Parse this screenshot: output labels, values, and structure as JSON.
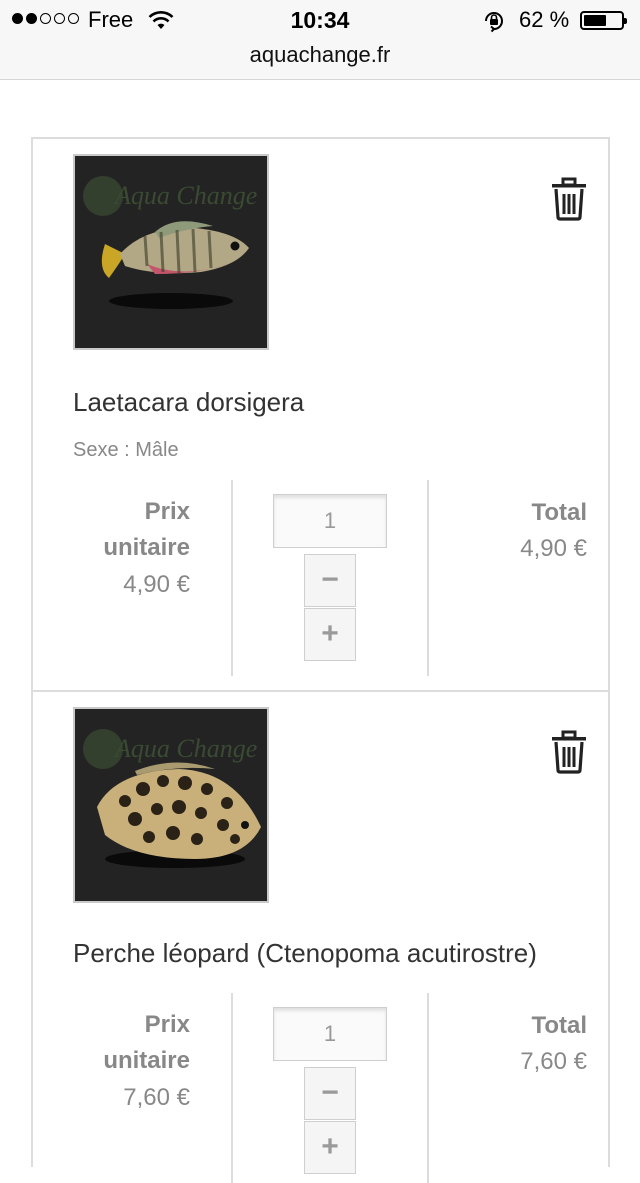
{
  "status_bar": {
    "carrier": "Free",
    "time": "10:34",
    "battery_percent": "62 %",
    "battery_level": 0.62,
    "signal_bars_filled": 2,
    "signal_bars_total": 5
  },
  "browser": {
    "url": "aquachange.fr"
  },
  "cart": {
    "items": [
      {
        "name": "Laetacara dorsigera",
        "attribute": "Sexe : Mâle",
        "unit_price_label_1": "Prix",
        "unit_price_label_2": "unitaire",
        "unit_price": "4,90 €",
        "quantity": "1",
        "decrement": "−",
        "increment": "+",
        "total_label": "Total",
        "total": "4,90 €",
        "image_icon": "fish-photo"
      },
      {
        "name": "Perche léopard (Ctenopoma acutirostre)",
        "unit_price_label_1": "Prix",
        "unit_price_label_2": "unitaire",
        "unit_price": "7,60 €",
        "quantity": "1",
        "decrement": "−",
        "increment": "+",
        "total_label": "Total",
        "total": "7,60 €",
        "image_icon": "fish-photo"
      }
    ]
  },
  "colors": {
    "border": "#dcdcdc",
    "muted_text": "#888888",
    "product_name": "#333333"
  }
}
